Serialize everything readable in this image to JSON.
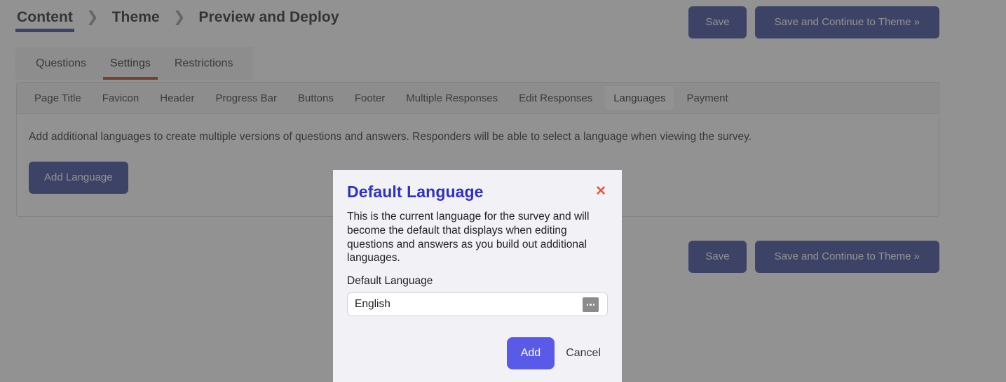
{
  "breadcrumb": {
    "separator_icon": "chevron-right-icon",
    "separator": "❯",
    "items": [
      {
        "label": "Content",
        "active": true
      },
      {
        "label": "Theme",
        "active": false
      },
      {
        "label": "Preview and Deploy",
        "active": false
      }
    ]
  },
  "header_actions": {
    "save_label": "Save",
    "save_continue_label": "Save and Continue to Theme »"
  },
  "tabs": [
    {
      "label": "Questions",
      "active": false
    },
    {
      "label": "Settings",
      "active": true
    },
    {
      "label": "Restrictions",
      "active": false
    }
  ],
  "subtabs": [
    {
      "label": "Page Title",
      "active": false
    },
    {
      "label": "Favicon",
      "active": false
    },
    {
      "label": "Header",
      "active": false
    },
    {
      "label": "Progress Bar",
      "active": false
    },
    {
      "label": "Buttons",
      "active": false
    },
    {
      "label": "Footer",
      "active": false
    },
    {
      "label": "Multiple Responses",
      "active": false
    },
    {
      "label": "Edit Responses",
      "active": false
    },
    {
      "label": "Languages",
      "active": true
    },
    {
      "label": "Payment",
      "active": false
    }
  ],
  "languages_panel": {
    "description": "Add additional languages to create multiple versions of questions and answers. Responders will be able to select a language when viewing the survey.",
    "add_language_label": "Add Language"
  },
  "footer_actions": {
    "save_label": "Save",
    "save_continue_label": "Save and Continue to Theme »"
  },
  "modal": {
    "title": "Default Language",
    "close_icon": "close-x-icon",
    "close_label": "✕",
    "body_text": "This is the current language for the survey and will become the default that displays when editing questions and answers as you build out additional languages.",
    "field_label": "Default Language",
    "field_value": "English",
    "field_button_icon": "ellipsis-picker-icon",
    "add_label": "Add",
    "cancel_label": "Cancel"
  },
  "colors": {
    "brand_indigo": "#3f4d9e",
    "modal_title_blue": "#2f31c4",
    "add_button_indigo": "#5a5ae8",
    "active_tab_orange": "#c04a20",
    "close_x_orange": "#f05537",
    "overlay": "rgba(61,61,61,0.56)"
  }
}
